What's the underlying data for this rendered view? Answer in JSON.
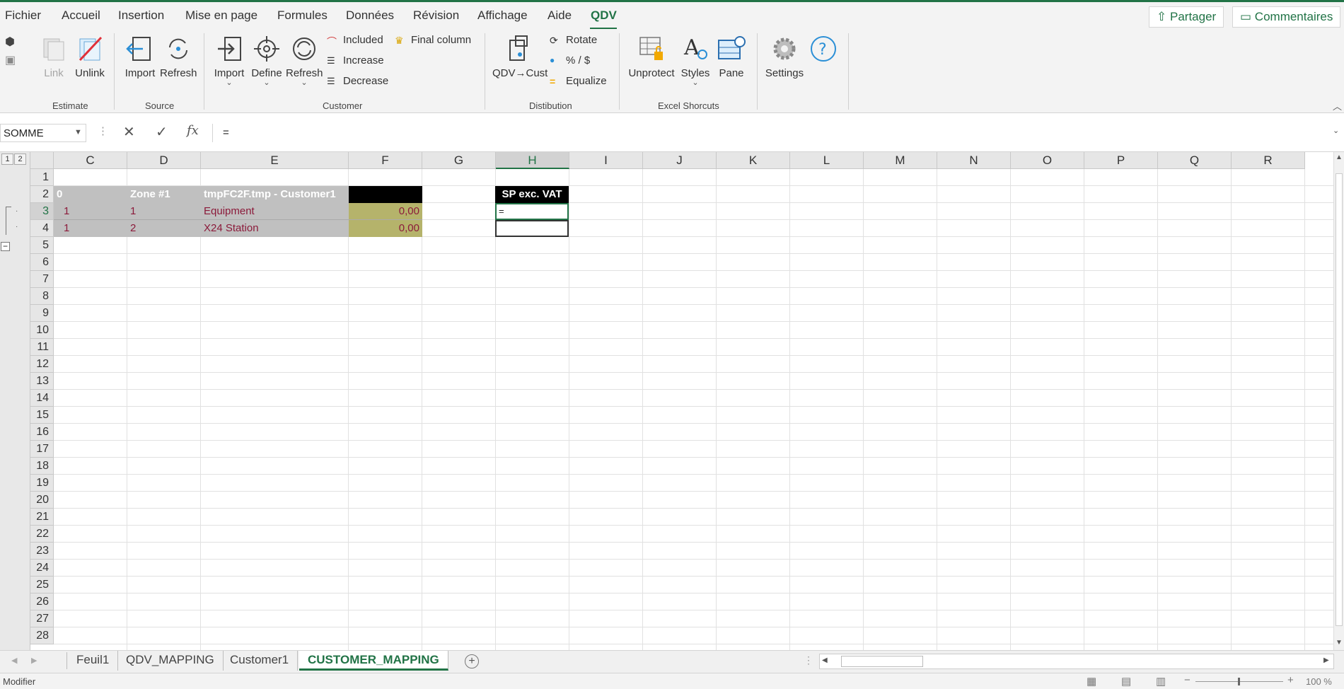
{
  "menu": {
    "tabs": [
      "Fichier",
      "Accueil",
      "Insertion",
      "Mise en page",
      "Formules",
      "Données",
      "Révision",
      "Affichage",
      "Aide",
      "QDV"
    ],
    "share_label": "Partager",
    "comments_label": "Commentaires"
  },
  "ribbon": {
    "link": "Link",
    "unlink": "Unlink",
    "import_source": "Import",
    "refresh_source": "Refresh",
    "import_customer": "Import",
    "define": "Define",
    "refresh_customer": "Refresh",
    "included": "Included",
    "increase": "Increase",
    "decrease": "Decrease",
    "final_column": "Final column",
    "qdv_cust": "QDV→Cust",
    "rotate": "Rotate",
    "percent_dollar": "% / $",
    "equalize": "Equalize",
    "unprotect": "Unprotect",
    "styles": "Styles",
    "pane": "Pane",
    "settings": "Settings",
    "groups": {
      "estimate": "Estimate",
      "source": "Source",
      "customer": "Customer",
      "distibution": "Distibution",
      "excel_shortcuts": "Excel Shorcuts"
    }
  },
  "formula_bar": {
    "name_box": "SOMME",
    "fx": "fx",
    "formula": "="
  },
  "grid": {
    "columns": [
      "C",
      "D",
      "E",
      "F",
      "G",
      "H",
      "I",
      "J",
      "K",
      "L",
      "M",
      "N",
      "O",
      "P",
      "Q",
      "R"
    ],
    "rows": [
      "1",
      "2",
      "3",
      "4",
      "5",
      "6",
      "7",
      "8",
      "9",
      "10",
      "11",
      "12",
      "13",
      "14",
      "15",
      "16",
      "17",
      "18",
      "19",
      "20",
      "21",
      "22",
      "23",
      "24",
      "25",
      "26",
      "27",
      "28"
    ],
    "outline_levels": [
      "1",
      "2"
    ],
    "cells": {
      "c2": "0",
      "d2": "Zone #1",
      "e2": "tmpFC2F.tmp - Customer1",
      "h2": "SP exc. VAT",
      "c3": "1",
      "d3": "1",
      "e3": "Equipment",
      "f3": "0,00",
      "h3": "=",
      "c4": "1",
      "d4": "2",
      "e4": "X24 Station",
      "f4": "0,00"
    }
  },
  "sheets": [
    "Feuil1",
    "QDV_MAPPING",
    "Customer1",
    "CUSTOMER_MAPPING"
  ],
  "status": {
    "mode": "Modifier",
    "zoom": "100 %"
  },
  "colors": {
    "accent": "#217346",
    "header_gray": "#c0c0c0",
    "olive": "#b5b36b",
    "dark_red": "#8b1a3a"
  }
}
